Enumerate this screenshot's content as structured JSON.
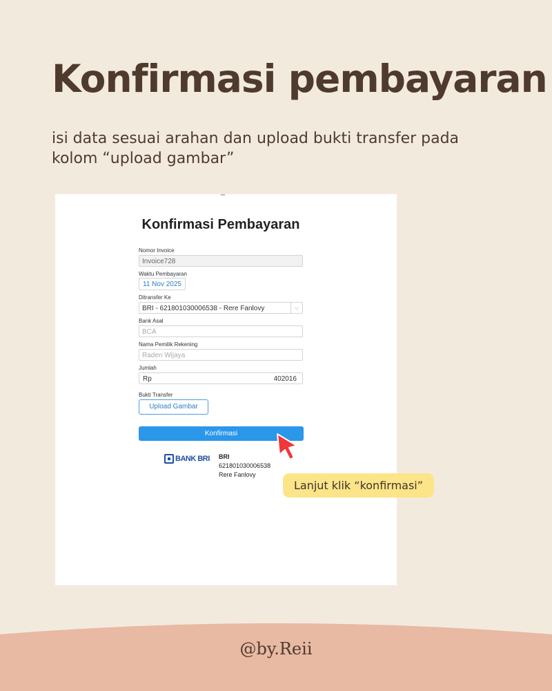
{
  "slide": {
    "title": "Konfirmasi pembayaran",
    "subtitle": "isi data sesuai arahan dan upload bukti transfer pada kolom “upload gambar”",
    "callout": "Lanjut klik “konfirmasi”",
    "handle": "@by.Reii"
  },
  "form": {
    "title": "Konfirmasi Pembayaran",
    "invoice": {
      "label": "Nomor Invoice",
      "value": "Invoice728"
    },
    "payment_time": {
      "label": "Waktu Pembayaran",
      "value": "11 Nov 2025"
    },
    "transfer_to": {
      "label": "Ditransfer Ke",
      "value": "BRI - 621801030006538 - Rere Fanlovy",
      "chevron": "chevron-down-icon"
    },
    "source_bank": {
      "label": "Bank Asal",
      "placeholder": "BCA"
    },
    "account_holder": {
      "label": "Nama Pemilik Rekening",
      "placeholder": "Raden Wijaya"
    },
    "amount": {
      "label": "Jumlah",
      "prefix": "Rp",
      "value": "402016"
    },
    "proof": {
      "label": "Bukti Transfer",
      "upload_label": "Upload Gambar"
    },
    "confirm_label": "Konfirmasi"
  },
  "bank": {
    "logo_text": "BANK BRI",
    "name": "BRI",
    "account_number": "621801030006538",
    "account_name": "Rere Fanlovy"
  },
  "colors": {
    "background": "#f3eade",
    "title": "#4f3a2e",
    "footer": "#e8b9a3",
    "callout": "#fce488",
    "confirm_button": "#2a97ea",
    "bri_blue": "#1e4fa0",
    "cursor": "#f0373a"
  }
}
